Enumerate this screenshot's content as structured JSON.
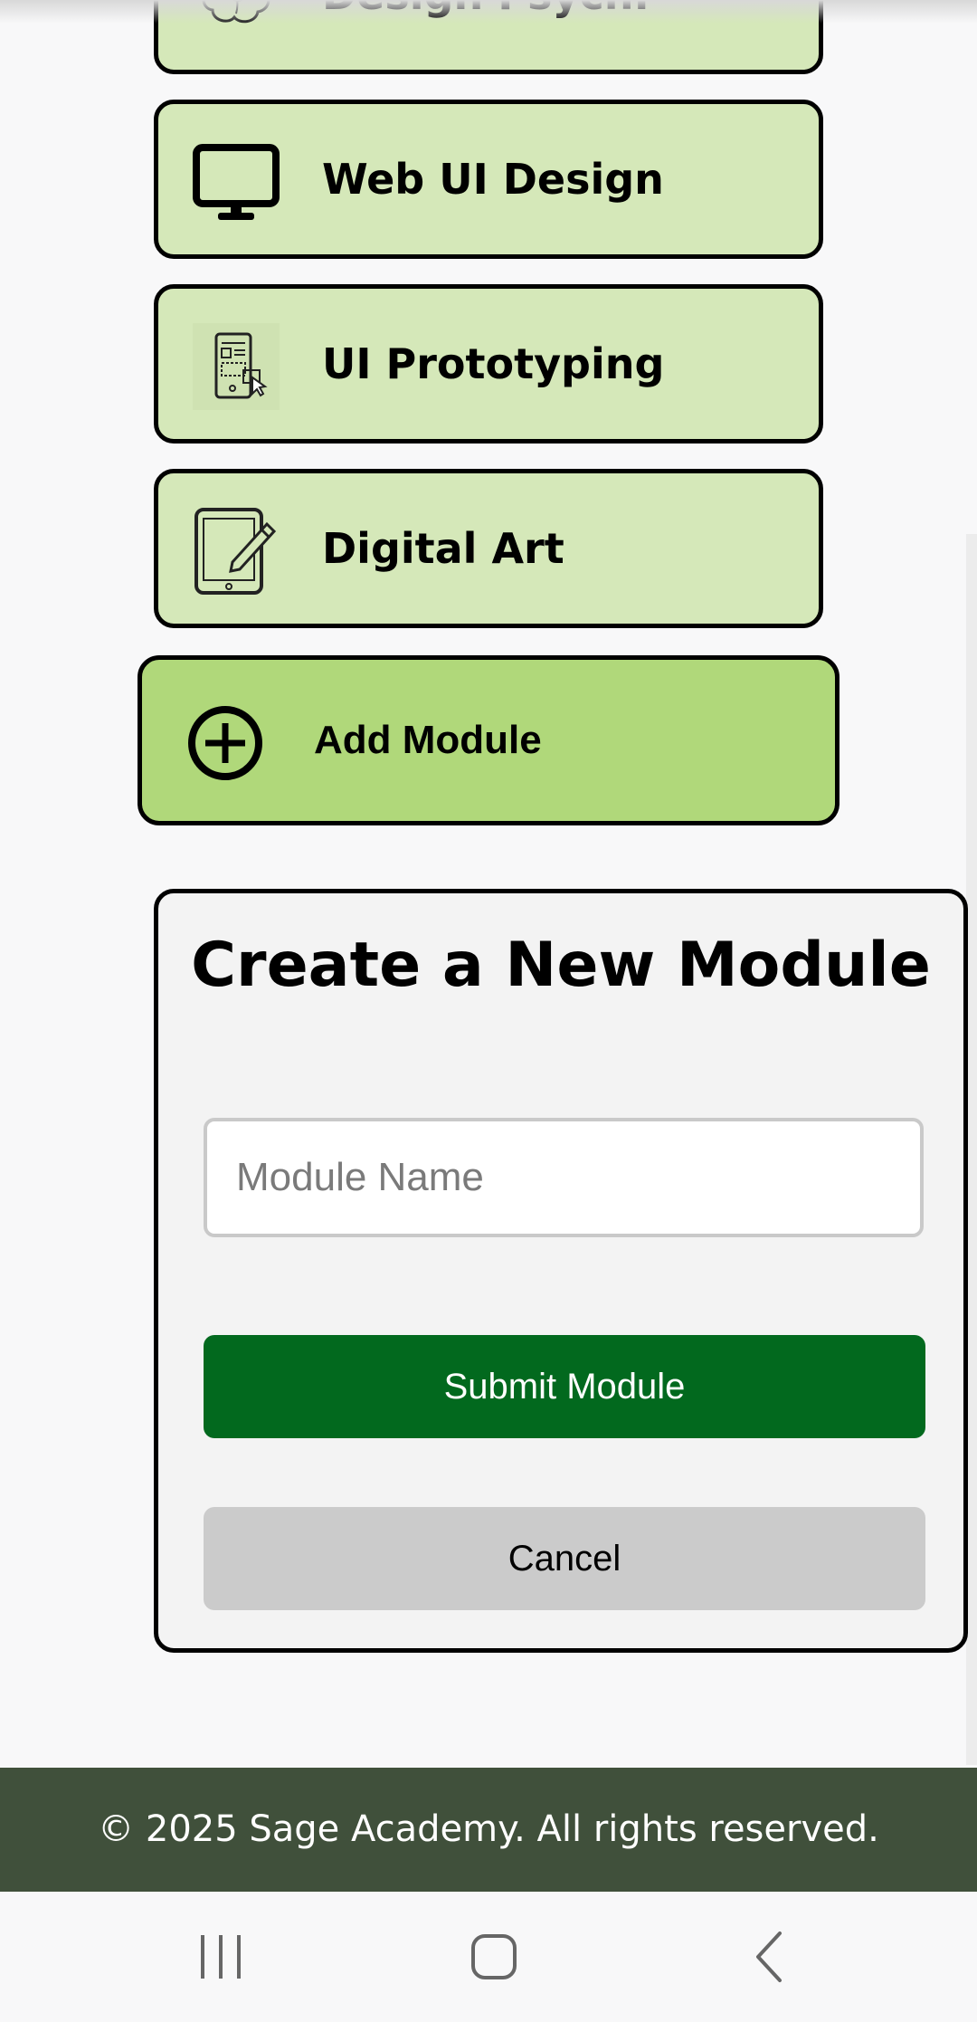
{
  "modules": [
    {
      "label": "Design Psych.",
      "icon": "brain-icon"
    },
    {
      "label": "Web UI Design",
      "icon": "monitor-icon"
    },
    {
      "label": "UI Prototyping",
      "icon": "prototype-icon"
    },
    {
      "label": "Digital Art",
      "icon": "tablet-pen-icon"
    }
  ],
  "add_module": {
    "label": "Add Module",
    "icon": "plus-circle-icon"
  },
  "modal": {
    "title": "Create a New Module",
    "input_placeholder": "Module Name",
    "input_value": "",
    "submit_label": "Submit Module",
    "cancel_label": "Cancel"
  },
  "footer": {
    "text": "© 2025 Sage Academy. All rights reserved."
  },
  "navbar": {
    "items": [
      "recent-apps-icon",
      "home-icon",
      "back-icon"
    ]
  },
  "colors": {
    "module_bg": "#d5e8b9",
    "add_module_bg": "#b0d87a",
    "submit_bg": "#02691e",
    "cancel_bg": "#cbcbcb",
    "footer_bg": "#40503b"
  }
}
